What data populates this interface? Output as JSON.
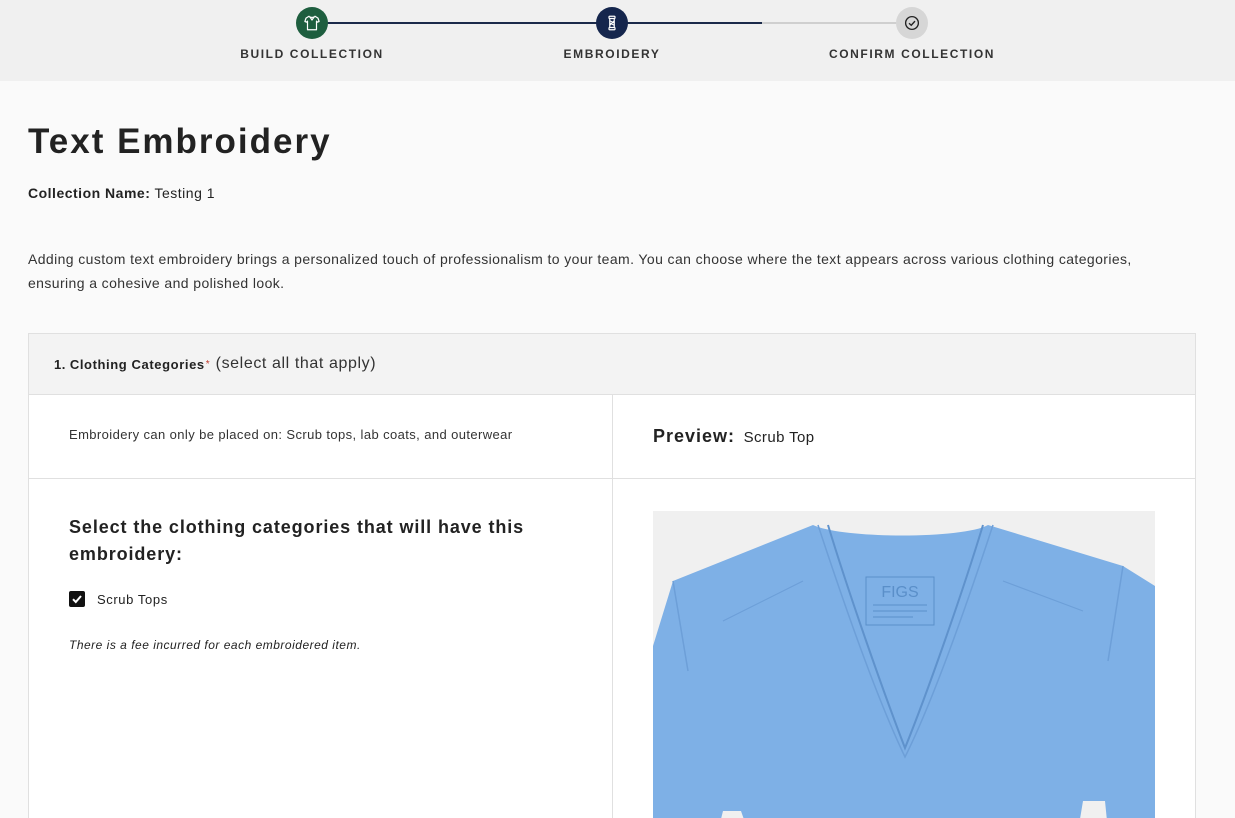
{
  "stepper": {
    "steps": [
      {
        "label": "BUILD COLLECTION",
        "state": "complete",
        "icon": "shirt-icon"
      },
      {
        "label": "EMBROIDERY",
        "state": "current",
        "icon": "thread-spool-icon"
      },
      {
        "label": "CONFIRM COLLECTION",
        "state": "upcoming",
        "icon": "check-circle-icon"
      }
    ]
  },
  "page": {
    "title": "Text Embroidery",
    "collection_label": "Collection Name:",
    "collection_value": "Testing 1",
    "intro": "Adding custom text embroidery brings a personalized touch of professionalism to your team. You can choose where the text appears across various clothing categories, ensuring a cohesive and polished look."
  },
  "section": {
    "number": "1.",
    "title": "Clothing Categories",
    "required_mark": "*",
    "hint": "(select all that apply)",
    "note": "Embroidery can only be placed on: Scrub tops, lab coats, and outerwear",
    "preview_label": "Preview:",
    "preview_value": "Scrub Top",
    "select_title": "Select the clothing categories that will have this embroidery:",
    "options": [
      {
        "label": "Scrub Tops",
        "checked": true
      }
    ],
    "fee_note": "There is a fee incurred for each embroidered item.",
    "image_logo_text": "FIGS"
  },
  "colors": {
    "step_complete": "#1e5e3f",
    "step_current": "#15264d",
    "step_upcoming": "#d6d6d6",
    "scrub_blue": "#7eb0e6"
  }
}
